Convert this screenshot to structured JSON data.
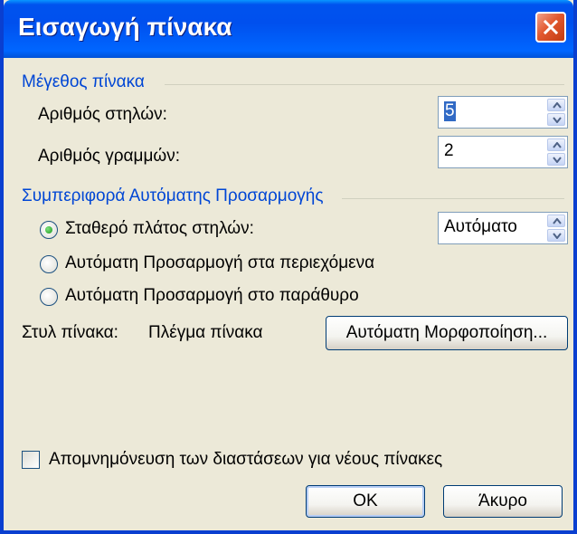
{
  "window": {
    "title": "Εισαγωγή πίνακα"
  },
  "size_group": {
    "label": "Μέγεθος πίνακα",
    "columns_label": "Αριθμός στηλών:",
    "columns_value": "5",
    "rows_label": "Αριθμός γραμμών:",
    "rows_value": "2"
  },
  "autofit_group": {
    "label": "Συμπεριφορά Αυτόματης Προσαρμογής",
    "fixed_width_label": "Σταθερό πλάτος στηλών:",
    "fixed_width_value": "Αυτόματο",
    "autofit_contents_label": "Αυτόματη Προσαρμογή στα περιεχόμενα",
    "autofit_window_label": "Αυτόματη Προσαρμογή στο παράθυρο",
    "selected_option": "fixed_width"
  },
  "table_style": {
    "label": "Στυλ πίνακα:",
    "value": "Πλέγμα πίνακα",
    "autoformat_button": "Αυτόματη Μορφοποίηση..."
  },
  "remember_checkbox": {
    "label": "Απομνημόνευση των διαστάσεων για νέους πίνακες",
    "checked": false
  },
  "buttons": {
    "ok": "OK",
    "cancel": "Άκυρο"
  },
  "icons": {
    "close": "close-icon",
    "spin_up": "spin-up-icon",
    "spin_down": "spin-down-icon"
  }
}
